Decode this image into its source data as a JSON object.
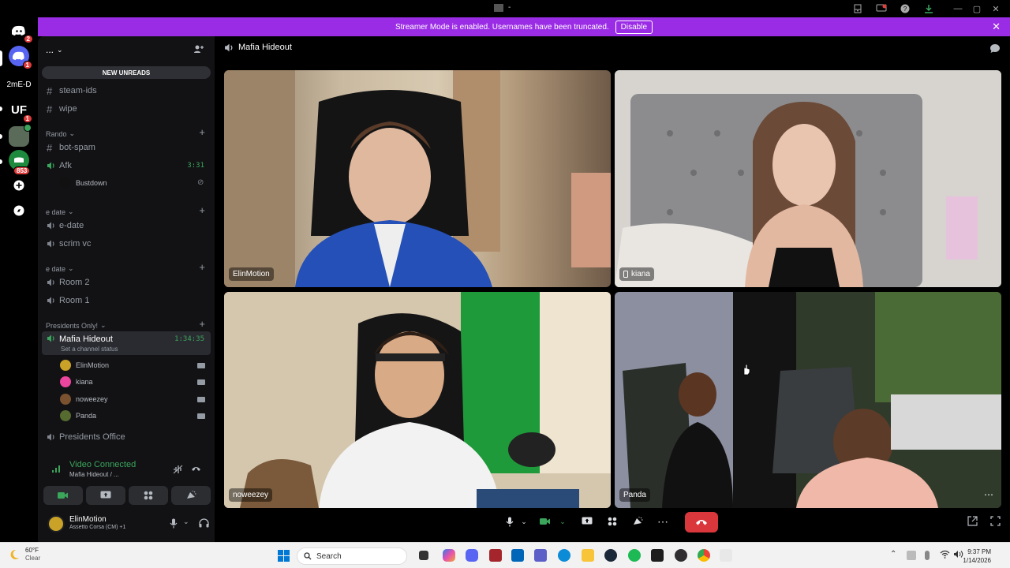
{
  "titlebar": {
    "center_text": "-"
  },
  "servers": [
    {
      "name": "discord-home",
      "badge": "2"
    },
    {
      "name": "discord-dm",
      "badge": "1"
    },
    {
      "name": "2mE-D",
      "label": "2mE-D"
    },
    {
      "name": "UF",
      "badge": "1"
    },
    {
      "name": "photo-server",
      "badge": ""
    },
    {
      "name": "green-server",
      "badge": "853"
    }
  ],
  "banner": {
    "text": "Streamer Mode is enabled. Usernames have been truncated.",
    "button": "Disable"
  },
  "sidebar": {
    "server_name": "...",
    "new_unreads": "NEW UNREADS",
    "channels_top": [
      "steam-ids",
      "wipe"
    ],
    "cat_rando": "Rando",
    "bot_spam": "bot-spam",
    "afk": "Afk",
    "afk_time": "3:31",
    "afk_user": "Bustdown",
    "cat_edate1": "e date",
    "edate": "e-date",
    "scrim": "scrim vc",
    "cat_edate2": "e date",
    "room2": "Room 2",
    "room1": "Room 1",
    "cat_presidents": "Presidents Only!",
    "active_channel": "Mafia Hideout",
    "active_time": "1:34:35",
    "channel_status": "Set a channel status",
    "voice_users": [
      "ElinMotion",
      "kiana",
      "noweezey",
      "Panda"
    ],
    "presidents_office": "Presidents Office"
  },
  "voice_panel": {
    "title": "Video Connected",
    "subtitle": "Mafia Hideout / ..."
  },
  "user": {
    "name": "ElinMotion",
    "status": "Assetto Corsa (CM) +1"
  },
  "main": {
    "title": "Mafia Hideout",
    "tiles": [
      {
        "label": "ElinMotion"
      },
      {
        "label": "kiana"
      },
      {
        "label": "noweezey"
      },
      {
        "label": "Panda"
      }
    ]
  },
  "taskbar": {
    "temp": "60°F",
    "weather": "Clear",
    "search": "Search",
    "time": "9:37 PM",
    "date": "1/14/2026"
  },
  "colors": {
    "banner": "#9b2ce6",
    "voice_green": "#3ba55c",
    "hangup": "#da373c"
  }
}
